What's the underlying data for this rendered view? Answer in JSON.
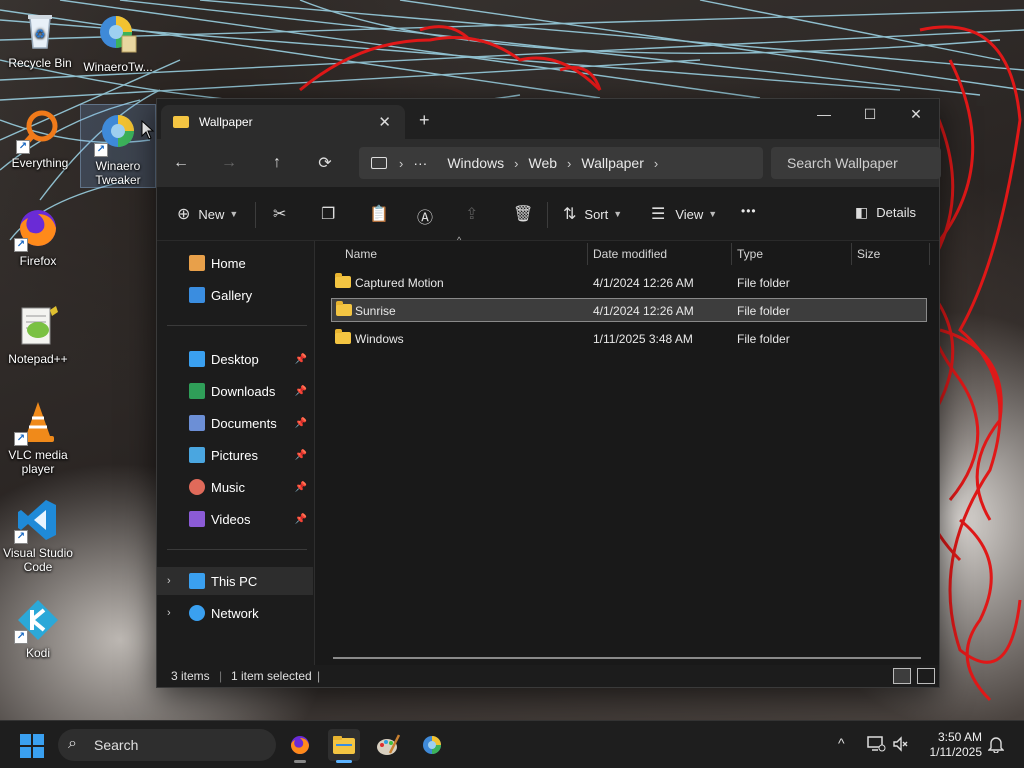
{
  "desktop": {
    "icons": [
      {
        "label": "Recycle Bin"
      },
      {
        "label": "WinaeroTw..."
      },
      {
        "label": "Everything"
      },
      {
        "label": "Winaero Tweaker"
      },
      {
        "label": "Firefox"
      },
      {
        "label": "Notepad++"
      },
      {
        "label": "VLC media player"
      },
      {
        "label": "Visual Studio Code"
      },
      {
        "label": "Kodi"
      }
    ],
    "shortcut_glyph": "↗"
  },
  "window": {
    "tab_title": "Wallpaper",
    "tab_close": "✕",
    "new_tab": "+",
    "controls": {
      "minimize": "—",
      "maximize": "☐",
      "close": "✕"
    },
    "nav": {
      "back": "←",
      "forward": "→",
      "up": "↑",
      "refresh": "⟳"
    },
    "breadcrumb": {
      "overflow": "···",
      "segments": [
        "Windows",
        "Web",
        "Wallpaper"
      ],
      "sep": "›"
    },
    "search_placeholder": "Search Wallpaper",
    "toolbar": {
      "new": "New",
      "sort": "Sort",
      "view": "View",
      "more": "•••",
      "details": "Details"
    },
    "sidebar": {
      "top": [
        {
          "label": "Home",
          "color": "#e8a04a"
        },
        {
          "label": "Gallery",
          "color": "#3a8de0"
        }
      ],
      "pinned": [
        {
          "label": "Desktop",
          "color": "#3aa0f0"
        },
        {
          "label": "Downloads",
          "color": "#2f9e58"
        },
        {
          "label": "Documents",
          "color": "#6c8fd6"
        },
        {
          "label": "Pictures",
          "color": "#4aa6e0"
        },
        {
          "label": "Music",
          "color": "#e06a5a"
        },
        {
          "label": "Videos",
          "color": "#8b5bd6"
        }
      ],
      "drives": [
        {
          "label": "This PC",
          "color": "#3aa0f0"
        },
        {
          "label": "Network",
          "color": "#3aa0f0"
        }
      ]
    },
    "columns": {
      "name": "Name",
      "date": "Date modified",
      "type": "Type",
      "size": "Size"
    },
    "files": [
      {
        "name": "Captured Motion",
        "date": "4/1/2024 12:26 AM",
        "type": "File folder",
        "size": ""
      },
      {
        "name": "Sunrise",
        "date": "4/1/2024 12:26 AM",
        "type": "File folder",
        "size": "",
        "selected": true
      },
      {
        "name": "Windows",
        "date": "1/11/2025 3:48 AM",
        "type": "File folder",
        "size": ""
      }
    ],
    "status": {
      "count": "3 items",
      "selection": "1 item selected",
      "divider": "|"
    }
  },
  "taskbar": {
    "search_label": "Search",
    "clock_time": "3:50 AM",
    "clock_date": "1/11/2025",
    "tray_chevron": "^"
  }
}
